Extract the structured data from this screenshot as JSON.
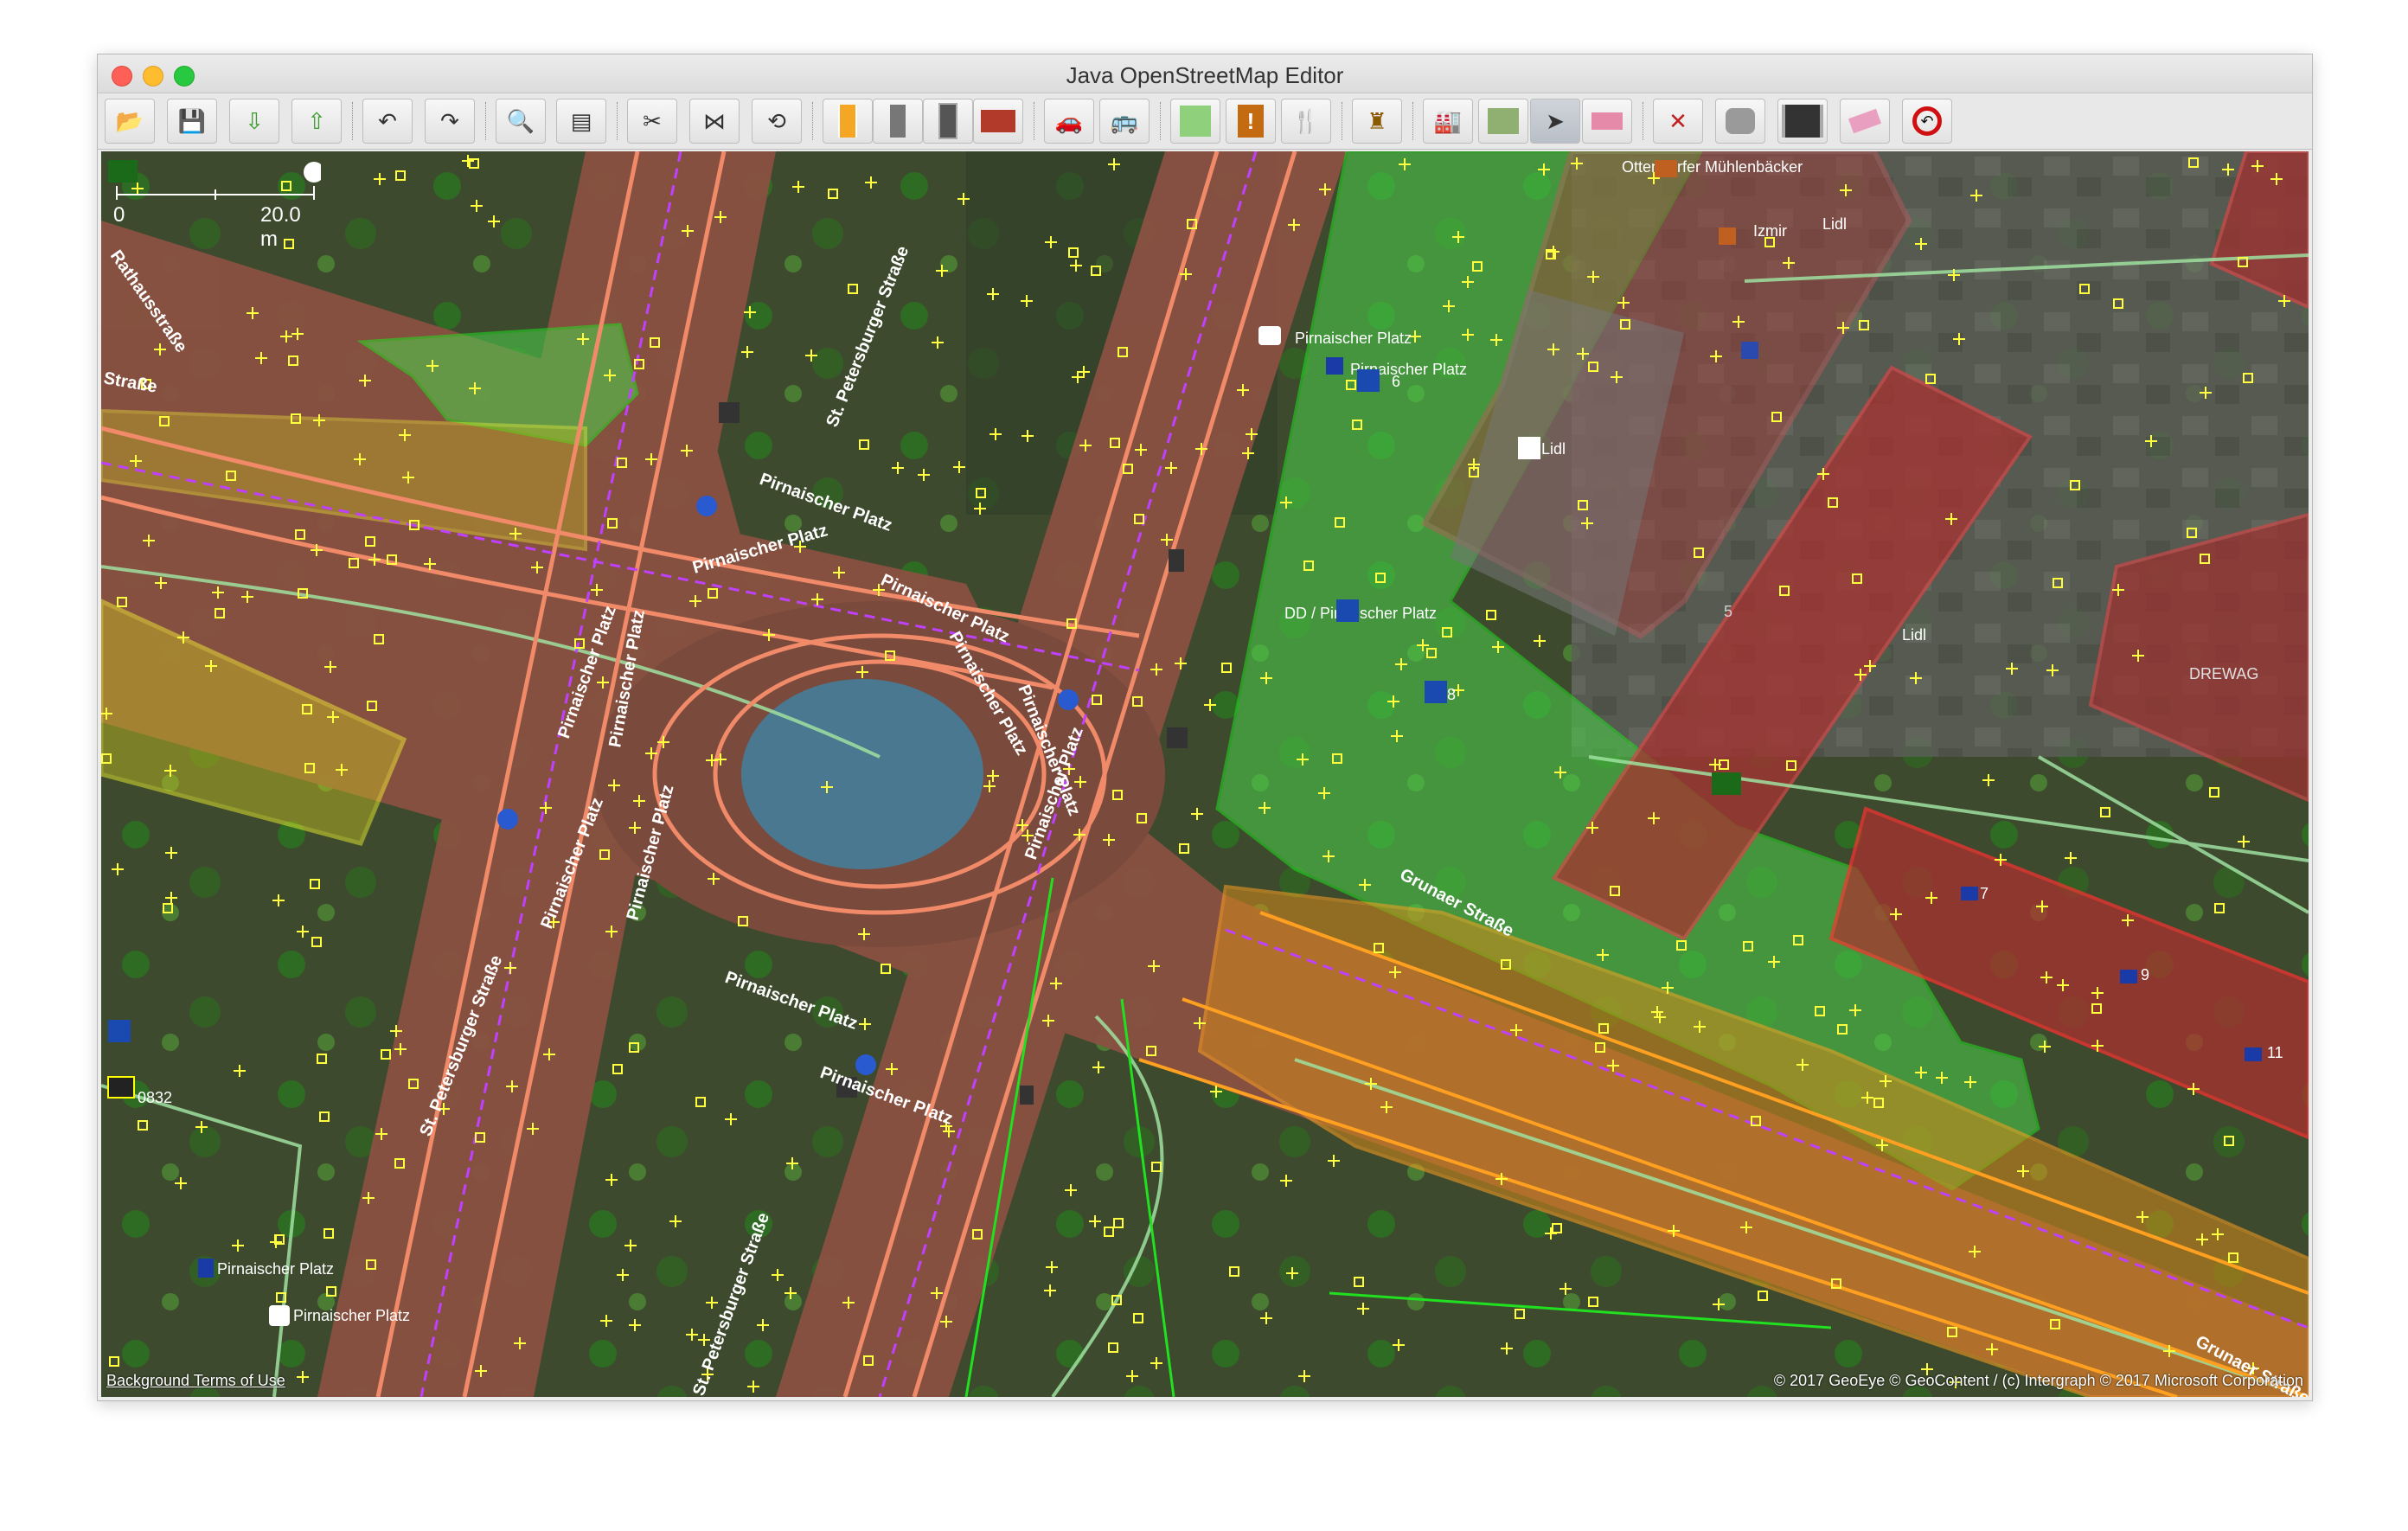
{
  "window": {
    "title": "Java OpenStreetMap Editor"
  },
  "toolbar": {
    "buttons": [
      {
        "icon": "open-file-icon"
      },
      {
        "icon": "save-icon"
      },
      {
        "icon": "download-icon"
      },
      {
        "icon": "upload-icon"
      },
      {
        "icon": "undo-icon"
      },
      {
        "icon": "redo-icon"
      },
      {
        "icon": "preferences-icon"
      },
      {
        "icon": "info-icon"
      },
      {
        "icon": "split-way-icon"
      },
      {
        "icon": "combine-way-icon"
      },
      {
        "icon": "reverse-way-icon"
      },
      {
        "icon": "preset-road-icon"
      },
      {
        "icon": "preset-rail-icon"
      },
      {
        "icon": "preset-traffic-signal-icon"
      },
      {
        "icon": "preset-wall-icon"
      },
      {
        "icon": "preset-car-icon"
      },
      {
        "icon": "preset-bus-icon"
      },
      {
        "icon": "preset-park-icon"
      },
      {
        "icon": "preset-emergency-icon"
      },
      {
        "icon": "preset-restaurant-icon"
      },
      {
        "icon": "preset-castle-icon"
      },
      {
        "icon": "preset-industrial-icon"
      },
      {
        "icon": "preset-landfill-icon"
      },
      {
        "icon": "select-tool-icon",
        "active": true
      },
      {
        "icon": "delete-tool-icon"
      },
      {
        "icon": "draw-tool-icon"
      },
      {
        "icon": "building-icon"
      },
      {
        "icon": "highway-icon"
      },
      {
        "icon": "eraser-icon"
      },
      {
        "icon": "no-u-turn-icon"
      }
    ]
  },
  "map": {
    "scale_zero": "0",
    "scale_value": "20.0 m",
    "background_terms": "Background Terms of Use",
    "attribution": "© 2017 GeoEye © GeoContent / (c) Intergraph © 2017 Microsoft Corporation",
    "streets": [
      "Pirnaischer Platz",
      "Pirnaischer Platz",
      "Pirnaischer Platz",
      "Pirnaischer Platz",
      "Pirnaischer Platz",
      "Pirnaischer Platz",
      "Pirnaischer Platz",
      "Pirnaischer Platz",
      "Pirnaischer Platz",
      "Pirnaischer Platz",
      "Pirnaischer Platz",
      "Pirnaischer Platz",
      "St. Petersburger Straße",
      "St. Petersburger Straße",
      "St. Petersburger Straße",
      "Grunaer Straße",
      "Grunaer Straße",
      "Straße",
      "Rathausstraße"
    ],
    "pois": [
      "Ottendorfer Mühlenbäcker",
      "Izmir",
      "Lidl",
      "Lidl",
      "Lidl",
      "DREWAG",
      "Pirnaischer Platz",
      "Pirnaischer Platz",
      "DD / Pirnaischer Platz",
      "Pirnaischer Platz",
      "Pirnaischer Platz",
      "5",
      "6",
      "7",
      "8",
      "9",
      "11",
      "0832"
    ]
  }
}
